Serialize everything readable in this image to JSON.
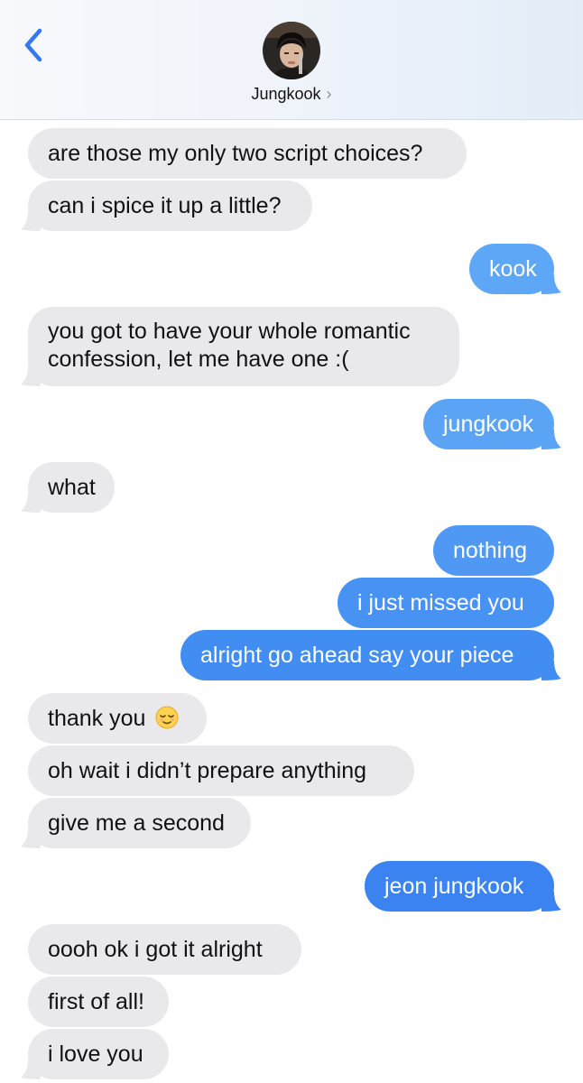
{
  "header": {
    "contact_name": "Jungkook",
    "chevron": "›",
    "back_icon": "chevron-left-icon",
    "accent_color": "#3478f6"
  },
  "messages": [
    {
      "from": "them",
      "text": "are those my only two script choices?"
    },
    {
      "from": "them",
      "text": "can i spice it up a little?"
    },
    {
      "from": "me",
      "text": "kook"
    },
    {
      "from": "them",
      "text": "you got to have your whole romantic confession, let me have one :("
    },
    {
      "from": "me",
      "text": "jungkook"
    },
    {
      "from": "them",
      "text": "what"
    },
    {
      "from": "me",
      "text": "nothing"
    },
    {
      "from": "me",
      "text": "i just missed you"
    },
    {
      "from": "me",
      "text": "alright go ahead say your piece"
    },
    {
      "from": "them",
      "text": "thank you",
      "emoji": "relieved-face"
    },
    {
      "from": "them",
      "text": "oh wait i didn’t prepare anything"
    },
    {
      "from": "them",
      "text": "give me a second"
    },
    {
      "from": "me",
      "text": "jeon jungkook"
    },
    {
      "from": "them",
      "text": "oooh ok i got it alright"
    },
    {
      "from": "them",
      "text": "first of all!"
    },
    {
      "from": "them",
      "text": "i love you"
    }
  ],
  "colors": {
    "incoming_bubble": "#e9e9eb",
    "outgoing_light": "#5ea7f6",
    "outgoing_mid": "#4a93f3",
    "outgoing_dark": "#3a83f1"
  }
}
